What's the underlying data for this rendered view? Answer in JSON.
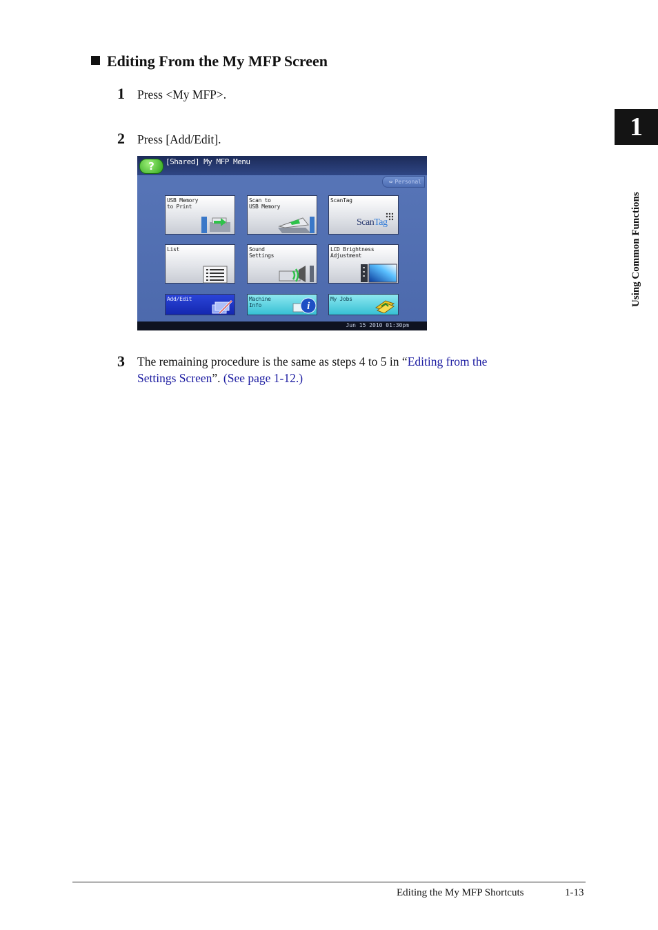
{
  "section": {
    "title": "Editing From the My MFP Screen"
  },
  "steps": [
    {
      "num": "1",
      "text": "Press <My MFP>."
    },
    {
      "num": "2",
      "text": "Press [Add/Edit]."
    },
    {
      "num": "3",
      "text_before": "The remaining procedure is the same as steps 4 to 5 in “",
      "link1_line1": "Editing from the",
      "link1_line2": "Settings Screen",
      "text_mid": "”. ",
      "link2": "(See page 1-12.)"
    }
  ],
  "chapter": {
    "number": "1",
    "side_label": "Using Common Functions"
  },
  "device_screen": {
    "title": "[Shared] My MFP Menu",
    "help_label": "?",
    "personal_label": "Personal",
    "tiles": [
      {
        "label": "USB Memory\nto Print",
        "icon": "usb-print-icon"
      },
      {
        "label": "Scan to\nUSB Memory",
        "icon": "scanner-icon"
      },
      {
        "label": "ScanTag",
        "icon": "scantag-logo",
        "logo_scan": "Scan",
        "logo_tag": "Tag"
      },
      {
        "label": "List",
        "icon": "list-icon"
      },
      {
        "label": "Sound\nSettings",
        "icon": "speaker-icon"
      },
      {
        "label": "LCD Brightness\nAdjustment",
        "icon": "lcd-brightness-icon"
      },
      {
        "label": "Add/Edit",
        "icon": "edit-pencil-icon"
      },
      {
        "label": "Machine\nInfo",
        "icon": "info-icon"
      },
      {
        "label": "My Jobs",
        "icon": "jobs-icon"
      }
    ],
    "timestamp": "Jun 15 2010 01:30pm",
    "colors": {
      "help": "#2ea41a",
      "add_edit": "#1428b0",
      "cyan_tiles": "#36c0d4"
    }
  },
  "footer": {
    "title": "Editing the My MFP Shortcuts",
    "page": "1-13"
  }
}
